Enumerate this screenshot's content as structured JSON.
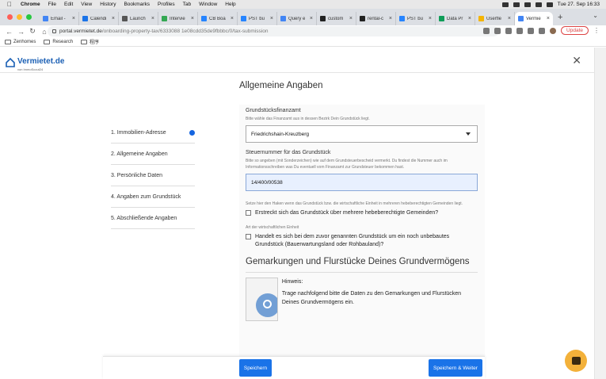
{
  "menubar": {
    "items": [
      "Chrome",
      "File",
      "Edit",
      "View",
      "History",
      "Bookmarks",
      "Profiles",
      "Tab",
      "Window",
      "Help"
    ],
    "datetime": "Tue 27. Sep  16:33"
  },
  "tabs": [
    {
      "label": "Email -",
      "color": "#4285f4"
    },
    {
      "label": "Calendi",
      "color": "#1a73e8"
    },
    {
      "label": "Launch",
      "color": "#555555"
    },
    {
      "label": "Intervie",
      "color": "#34a853"
    },
    {
      "label": "CB Boa",
      "color": "#2684ff"
    },
    {
      "label": "PST bu",
      "color": "#2684ff"
    },
    {
      "label": "Query e",
      "color": "#4285f4"
    },
    {
      "label": "custom",
      "color": "#222222"
    },
    {
      "label": "rental-c",
      "color": "#222222"
    },
    {
      "label": "PST bu",
      "color": "#2684ff"
    },
    {
      "label": "Data Pr",
      "color": "#0f9d58"
    },
    {
      "label": "Userfle",
      "color": "#f4b400"
    },
    {
      "label": "Vermie",
      "color": "#4285f4",
      "active": true
    }
  ],
  "address": {
    "domain": "portal.vermietet.de",
    "path": "/onboarding-property-tax/6333088 1e08cdd35de9fbbbc/0/tax-submission",
    "update_label": "Update"
  },
  "bookmarks": [
    "Zenhomes",
    "Research",
    "程序"
  ],
  "app": {
    "logo": "Vermietet.de",
    "logo_sub": "von ImmoScout24",
    "page_title": "Allgemeine Angaben"
  },
  "steps": [
    {
      "label": "1. Immobilien-Adresse",
      "current": true
    },
    {
      "label": "2. Allgemeine Angaben"
    },
    {
      "label": "3. Persönliche Daten"
    },
    {
      "label": "4. Angaben zum Grundstück"
    },
    {
      "label": "5. Abschließende Angaben"
    }
  ],
  "form": {
    "finanzamt_label": "Grundstücksfinanzamt",
    "finanzamt_hint": "Bitte wähle das Finanzamt aus in dessen Bezirk Dein Grundstück liegt.",
    "finanzamt_value": "Friedrichshain-Kreuzberg",
    "steuernummer_label": "Steuernummer für das Grundstück",
    "steuernummer_hint": "Bitte so angeben (mit Sonderzeichen) wie auf dem Grundsteuerbescheid vermerkt. Du findest die Nummer auch im Informationsschreiben was Du eventuell vom Finanzamt zur Grundsteuer bekommen hast.",
    "steuernummer_value": "14/400/00538",
    "mehrere_hint": "Setze hier den Haken wenn das Grundstück bzw. die wirtschaftliche Einheit in mehreren hebeberechtigten Gemeinden liegt.",
    "mehrere_label": "Erstreckt sich das Grundstück über mehrere hebeberechtigte Gemeinden?",
    "art_hint": "Art der wirtschaftlichen Einheit",
    "art_label": "Handelt es sich bei dem zuvor genannten Grundstück um ein noch unbebautes Grundstück (Bauerwartungsland oder Rohbauland)?",
    "section_title": "Gemarkungen und Flurstücke Deines Grundvermögens",
    "hinweis_title": "Hinweis:",
    "hinweis_text": "Trage nachfolgend bitte die Daten zu den Gemarkungen und Flurstücken Deines Grundvermögens ein."
  },
  "footer": {
    "save_label": "Speichern",
    "save_next_label": "Speichern & Weiter"
  },
  "colors": {
    "accent": "#1a73e8",
    "chat": "#f3b13a"
  }
}
